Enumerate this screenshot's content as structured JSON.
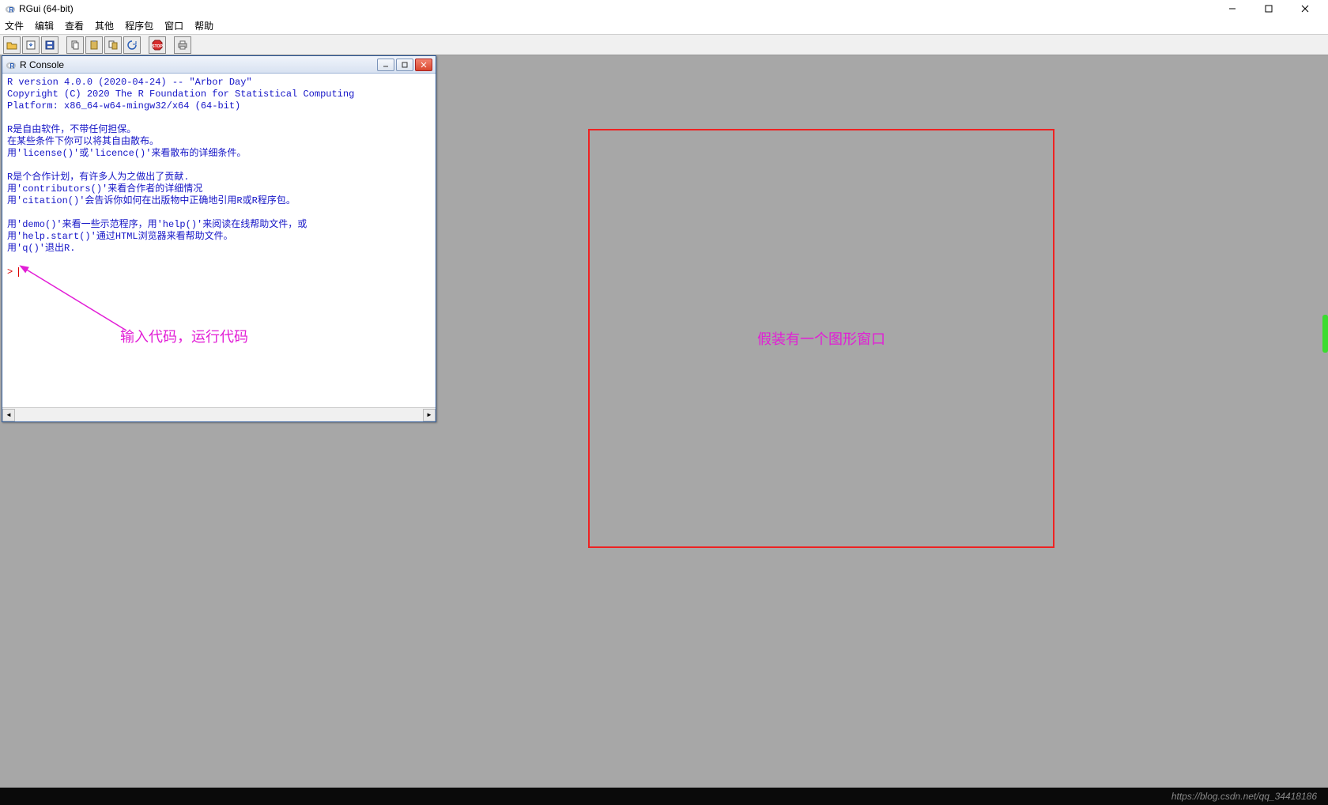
{
  "window": {
    "title": "RGui (64-bit)"
  },
  "menu": {
    "file": "文件",
    "edit": "编辑",
    "view": "查看",
    "misc": "其他",
    "packages": "程序包",
    "windows": "窗口",
    "help": "帮助"
  },
  "toolbar_icons": [
    "open-icon",
    "load-icon",
    "save-icon",
    "copy-icon",
    "paste-icon",
    "copypaste-icon",
    "refresh-icon",
    "stop-icon",
    "print-icon"
  ],
  "console": {
    "title": "R Console",
    "lines": [
      "R version 4.0.0 (2020-04-24) -- \"Arbor Day\"",
      "Copyright (C) 2020 The R Foundation for Statistical Computing",
      "Platform: x86_64-w64-mingw32/x64 (64-bit)",
      "",
      "R是自由软件，不带任何担保。",
      "在某些条件下你可以将其自由散布。",
      "用'license()'或'licence()'来看散布的详细条件。",
      "",
      "R是个合作计划，有许多人为之做出了贡献.",
      "用'contributors()'来看合作者的详细情况",
      "用'citation()'会告诉你如何在出版物中正确地引用R或R程序包。",
      "",
      "用'demo()'来看一些示范程序，用'help()'来阅读在线帮助文件，或",
      "用'help.start()'通过HTML浏览器来看帮助文件。",
      "用'q()'退出R.",
      ""
    ],
    "prompt": "> "
  },
  "annotations": {
    "arrow_label": "输入代码，运行代码",
    "fake_window": "假装有一个图形窗口"
  },
  "watermark": "https://blog.csdn.net/qq_34418186"
}
